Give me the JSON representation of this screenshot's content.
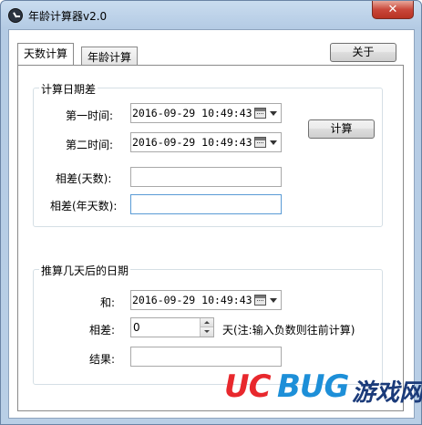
{
  "window": {
    "title": "年龄计算器v2.0",
    "close_label": "✕"
  },
  "toolbar": {
    "about_label": "关于"
  },
  "tabs": [
    {
      "label": "天数计算"
    },
    {
      "label": "年龄计算"
    }
  ],
  "group1": {
    "title": "计算日期差",
    "first_time_label": "第一时间:",
    "first_time_value": "2016-09-29 10:49:43",
    "second_time_label": "第二时间:",
    "second_time_value": "2016-09-29 10:49:43",
    "calc_label": "计算",
    "diff_days_label": "相差(天数):",
    "diff_years_label": "相差(年天数):"
  },
  "group2": {
    "title": "推算几天后的日期",
    "and_label": "和:",
    "and_value": "2016-09-29 10:49:43",
    "diff_label": "相差:",
    "diff_value": "0",
    "diff_note": "天(注:输入负数则往前计算)",
    "result_label": "结果:"
  },
  "watermark": {
    "uc": "UC",
    "bug": "BUG",
    "cn": "游戏网"
  }
}
